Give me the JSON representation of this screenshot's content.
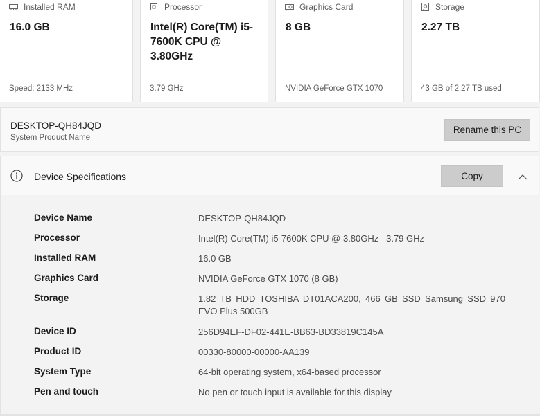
{
  "cards": [
    {
      "label": "Installed RAM",
      "value": "16.0 GB",
      "sub": "Speed: 2133 MHz",
      "icon": "ram-icon"
    },
    {
      "label": "Processor",
      "value": "Intel(R) Core(TM) i5-7600K CPU @ 3.80GHz",
      "sub": "3.79 GHz",
      "icon": "processor-icon"
    },
    {
      "label": "Graphics Card",
      "value": "8 GB",
      "sub": "NVIDIA GeForce GTX 1070",
      "icon": "graphics-card-icon"
    },
    {
      "label": "Storage",
      "value": "2.27 TB",
      "sub": "43 GB of 2.27 TB used",
      "icon": "storage-icon"
    }
  ],
  "pc": {
    "name": "DESKTOP-QH84JQD",
    "subtitle": "System Product Name",
    "rename_label": "Rename this PC"
  },
  "specs": {
    "title": "Device Specifications",
    "copy_label": "Copy",
    "rows": [
      {
        "key": "Device Name",
        "value": "DESKTOP-QH84JQD"
      },
      {
        "key": "Processor",
        "value": "Intel(R) Core(TM) i5-7600K CPU @ 3.80GHz   3.79 GHz"
      },
      {
        "key": "Installed RAM",
        "value": "16.0 GB"
      },
      {
        "key": "Graphics Card",
        "value": "NVIDIA GeForce GTX 1070 (8 GB)"
      },
      {
        "key": "Storage",
        "value": "1.82 TB HDD TOSHIBA DT01ACA200, 466 GB SSD Samsung SSD 970 EVO Plus 500GB"
      },
      {
        "key": "Device ID",
        "value": "256D94EF-DF02-441E-BB63-BD33819C145A"
      },
      {
        "key": "Product ID",
        "value": "00330-80000-00000-AA139"
      },
      {
        "key": "System Type",
        "value": "64-bit operating system, x64-based processor"
      },
      {
        "key": "Pen and touch",
        "value": "No pen or touch input is available for this display"
      }
    ]
  }
}
